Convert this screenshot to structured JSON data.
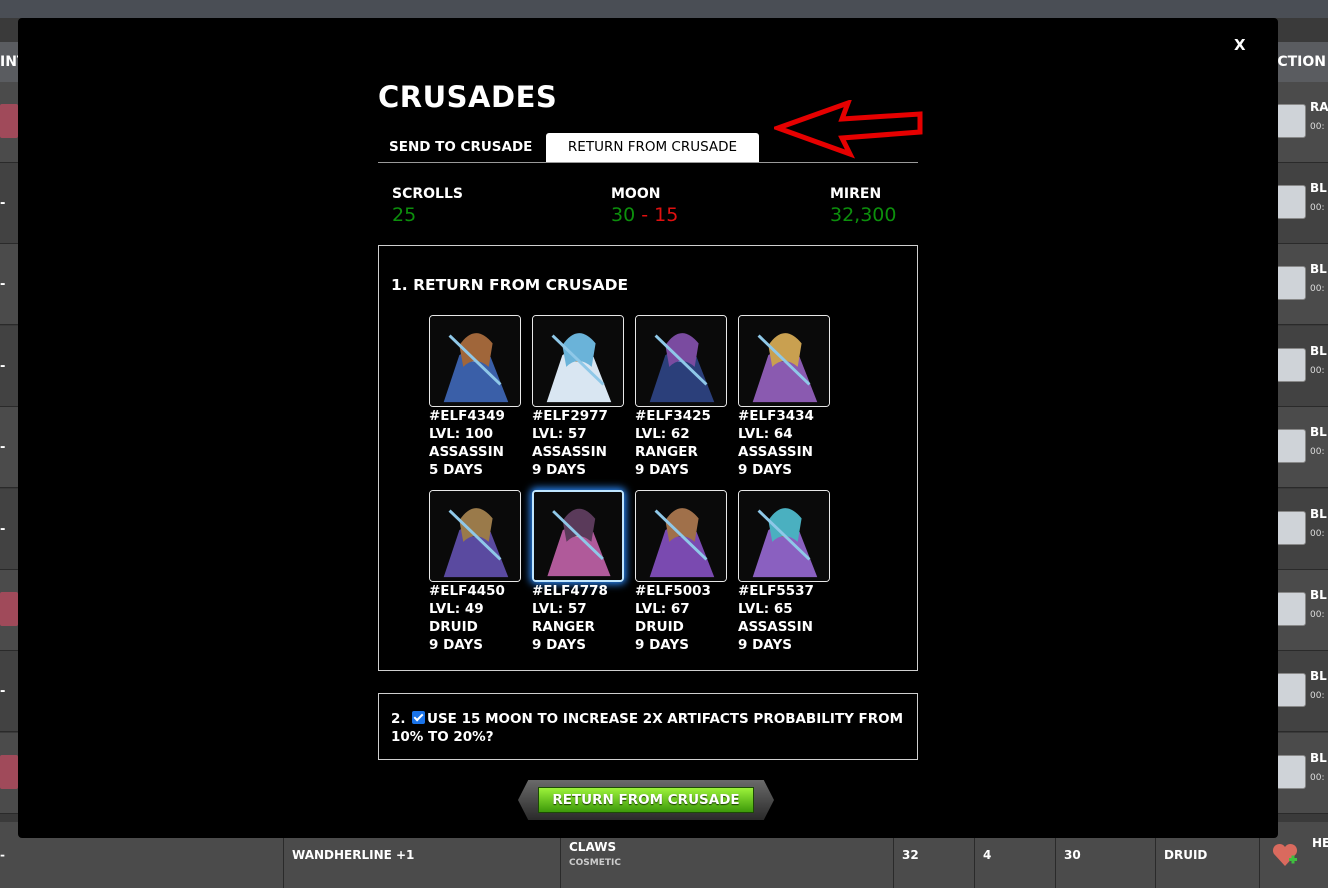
{
  "background": {
    "header_left": "INT",
    "header_right": "CTION",
    "rows": [
      {
        "left": "",
        "name": "RA",
        "time": "00:"
      },
      {
        "left": "-",
        "name": "BL",
        "time": "00:"
      },
      {
        "left": "-",
        "name": "BL",
        "time": "00:"
      },
      {
        "left": "-",
        "name": "BL",
        "time": "00:"
      },
      {
        "left": "-",
        "name": "BL",
        "time": "00:"
      },
      {
        "left": "-",
        "name": "BL",
        "time": "00:"
      },
      {
        "left": "",
        "name": "BL",
        "time": "00:"
      },
      {
        "left": "-",
        "name": "BL",
        "time": "00:"
      },
      {
        "left": "",
        "name": "BL",
        "time": "00:"
      }
    ],
    "bottom_row": {
      "dash": "-",
      "item": "WANDHERLINE +1",
      "type": "CLAWS",
      "subtype": "COSMETIC",
      "v1": "32",
      "v2": "4",
      "v3": "30",
      "class": "DRUID",
      "action": "HE"
    }
  },
  "modal": {
    "close_label": "X",
    "title": "CRUSADES",
    "tabs": [
      {
        "label": "SEND TO CRUSADE",
        "active": false
      },
      {
        "label": "RETURN FROM CRUSADE",
        "active": true
      }
    ],
    "stats": {
      "scrolls_label": "SCROLLS",
      "scrolls_value": "25",
      "moon_label": "MOON",
      "moon_value_a": "30",
      "moon_sep": " - ",
      "moon_value_b": "15",
      "miren_label": "MIREN",
      "miren_value": "32,300"
    },
    "section1_title": "1. RETURN FROM CRUSADE",
    "elves": [
      {
        "id": "#ELF4349",
        "lvl": "LVL: 100",
        "class": "ASSASSIN",
        "days": "5 DAYS",
        "selected": false
      },
      {
        "id": "#ELF2977",
        "lvl": "LVL: 57",
        "class": "ASSASSIN",
        "days": "9 DAYS",
        "selected": false
      },
      {
        "id": "#ELF3425",
        "lvl": "LVL: 62",
        "class": "RANGER",
        "days": "9 DAYS",
        "selected": false
      },
      {
        "id": "#ELF3434",
        "lvl": "LVL: 64",
        "class": "ASSASSIN",
        "days": "9 DAYS",
        "selected": false
      },
      {
        "id": "#ELF4450",
        "lvl": "LVL: 49",
        "class": "DRUID",
        "days": "9 DAYS",
        "selected": false
      },
      {
        "id": "#ELF4778",
        "lvl": "LVL: 57",
        "class": "RANGER",
        "days": "9 DAYS",
        "selected": true
      },
      {
        "id": "#ELF5003",
        "lvl": "LVL: 67",
        "class": "DRUID",
        "days": "9 DAYS",
        "selected": false
      },
      {
        "id": "#ELF5537",
        "lvl": "LVL: 65",
        "class": "ASSASSIN",
        "days": "9 DAYS",
        "selected": false
      }
    ],
    "section2_number": "2.",
    "section2_checked": true,
    "section2_text": "USE 15 MOON TO INCREASE 2X ARTIFACTS PROBABILITY FROM 10% TO 20%?",
    "cta_label": "RETURN FROM CRUSADE"
  },
  "colors": {
    "positive": "#0c8f0c",
    "negative": "#e01010",
    "arrow": "#e60000",
    "cta": "#6bd11a"
  }
}
